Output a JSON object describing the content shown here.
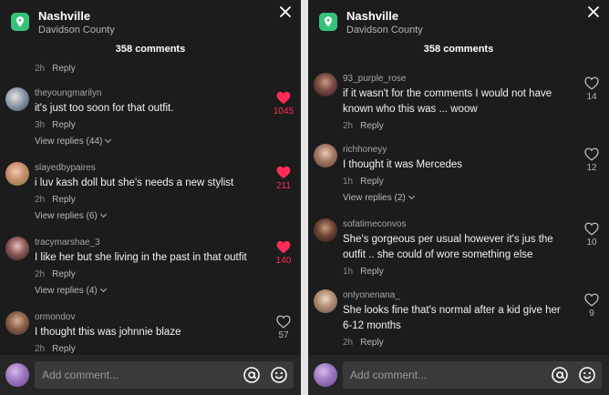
{
  "panels": [
    {
      "header": {
        "title": "Nashville",
        "subtitle": "Davidson County",
        "comments_count": "358 comments"
      },
      "top_meta": {
        "time": "2h",
        "reply": "Reply"
      },
      "comments": [
        {
          "username": "theyoungmarilyn",
          "text": "it's just too soon for that outfit.",
          "time": "3h",
          "reply": "Reply",
          "view_replies": "View replies (44)",
          "likes": "1045",
          "liked": true
        },
        {
          "username": "slayedbypaires",
          "text": "i luv kash doll but she's needs a new stylist",
          "time": "2h",
          "reply": "Reply",
          "view_replies": "View replies (6)",
          "likes": "211",
          "liked": true
        },
        {
          "username": "tracymarshae_3",
          "text": "I like her but she living in the past in that outfit",
          "time": "2h",
          "reply": "Reply",
          "view_replies": "View replies (4)",
          "likes": "140",
          "liked": true
        },
        {
          "username": "ormondov",
          "text": "I thought this was johnnie blaze",
          "time": "2h",
          "reply": "Reply",
          "view_replies": "",
          "likes": "57",
          "liked": false
        }
      ],
      "input": {
        "placeholder": "Add comment..."
      }
    },
    {
      "header": {
        "title": "Nashville",
        "subtitle": "Davidson County",
        "comments_count": "358 comments"
      },
      "comments": [
        {
          "username": "93_purple_rose",
          "text": "if it wasn't for the comments I would not have known who this was ... woow",
          "time": "2h",
          "reply": "Reply",
          "view_replies": "",
          "likes": "14",
          "liked": false
        },
        {
          "username": "richhoneyy",
          "text": "I thought it was Mercedes",
          "time": "1h",
          "reply": "Reply",
          "view_replies": "View replies (2)",
          "likes": "12",
          "liked": false
        },
        {
          "username": "sofatimeconvos",
          "text": "She's gorgeous per usual however it's jus the outfit .. she could of wore something else",
          "time": "1h",
          "reply": "Reply",
          "view_replies": "",
          "likes": "10",
          "liked": false
        },
        {
          "username": "onlyonenana_",
          "text": "She looks fine that's normal after a kid give her 6-12 months",
          "time": "2h",
          "reply": "Reply",
          "view_replies": "",
          "likes": "9",
          "liked": false
        }
      ],
      "input": {
        "placeholder": "Add comment..."
      }
    }
  ],
  "icons": {
    "location": "location-pin-icon",
    "close": "close-icon",
    "like": "heart-icon",
    "mention": "at-sign-icon",
    "emoji": "smiley-icon",
    "expand": "chevron-down-icon"
  },
  "colors": {
    "background": "#1c1c1c",
    "bottom_bar": "#262626",
    "input_bg": "#3a3a3a",
    "liked": "#fe2c55",
    "location_icon": "#35c37a",
    "muted_text": "#8a8a8a"
  }
}
